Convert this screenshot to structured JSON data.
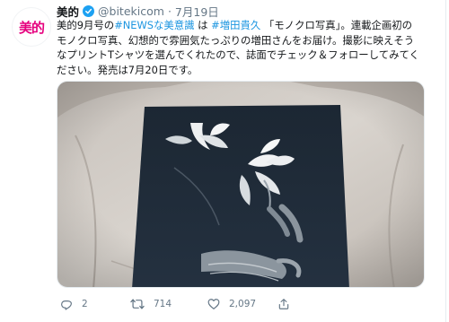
{
  "tweet": {
    "author_name": "美的",
    "author_handle": "@bitekicom",
    "separator": "·",
    "date": "7月19日",
    "text_parts": [
      {
        "text": "美的9月号の",
        "link": false
      },
      {
        "text": "#NEWSな美意識",
        "link": true
      },
      {
        "text": " は ",
        "link": false
      },
      {
        "text": "#増田貴久",
        "link": true
      },
      {
        "text": " 「モノクロ写真」。連載企画初のモノクロ写真、幻想的で雰囲気たっぷりの増田さんをお届け。撮影に映えそうなプリントTシャツを選んでくれたので、誌面でチェック＆フォローしてみてください。発売は7月20日です。",
        "link": false
      }
    ]
  },
  "avatar": {
    "logo_text": "美的",
    "logo_color": "#e6007e"
  },
  "colors": {
    "link": "#1b95e0",
    "muted": "#657786",
    "verified": "#1da1f2"
  },
  "actions": {
    "reply_count": "2",
    "retweet_count": "714",
    "like_count": "2,097"
  }
}
